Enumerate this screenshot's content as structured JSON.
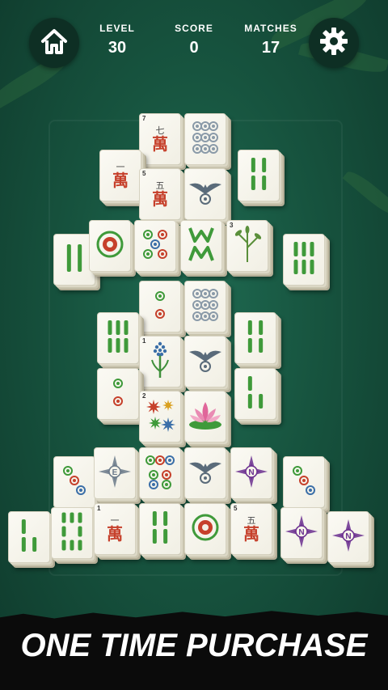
{
  "hud": {
    "level_label": "LEVEL",
    "level_value": "30",
    "score_label": "SCORE",
    "score_value": "0",
    "matches_label": "MATCHES",
    "matches_value": "17",
    "home_icon": "home-icon",
    "settings_icon": "gear-icon"
  },
  "tiles": {
    "t01": {
      "kind": "character",
      "num": "7",
      "top": "七",
      "main": "萬"
    },
    "t02": {
      "kind": "circles-9"
    },
    "t03": {
      "kind": "character",
      "num": "",
      "top": "一",
      "main": "萬"
    },
    "t04": {
      "kind": "character",
      "num": "5",
      "top": "五",
      "main": "萬"
    },
    "t05": {
      "kind": "eagle"
    },
    "t06": {
      "kind": "bamboo",
      "count": 4
    },
    "t07": {
      "kind": "bamboo",
      "count": 2
    },
    "t08": {
      "kind": "circle-1"
    },
    "t09": {
      "kind": "circles-5"
    },
    "t10": {
      "kind": "wm"
    },
    "t11": {
      "kind": "bamboo-plant",
      "num": "3"
    },
    "t12": {
      "kind": "bamboo",
      "count": 6
    },
    "t13": {
      "kind": "circles-2"
    },
    "t14": {
      "kind": "circles-9"
    },
    "t15": {
      "kind": "bamboo",
      "count": 6
    },
    "t16": {
      "kind": "bamboo",
      "count": 4
    },
    "t17": {
      "kind": "flower",
      "num": "1"
    },
    "t18": {
      "kind": "eagle"
    },
    "t19": {
      "kind": "circles-2"
    },
    "t20": {
      "kind": "bamboo",
      "count": 3
    },
    "t21": {
      "kind": "flowers",
      "num": "2"
    },
    "t22": {
      "kind": "lotus"
    },
    "t23": {
      "kind": "circles-3"
    },
    "t24": {
      "kind": "compass",
      "letter": "E"
    },
    "t25": {
      "kind": "circles-7"
    },
    "t26": {
      "kind": "eagle"
    },
    "t27": {
      "kind": "compass",
      "letter": "N"
    },
    "t28": {
      "kind": "circles-3"
    },
    "t29": {
      "kind": "bamboo",
      "count": 3
    },
    "t30": {
      "kind": "bamboo",
      "count": 8
    },
    "t31": {
      "kind": "character",
      "num": "1",
      "top": "一",
      "main": "萬"
    },
    "t32": {
      "kind": "bamboo",
      "count": 4
    },
    "t33": {
      "kind": "circle-1"
    },
    "t34": {
      "kind": "character",
      "num": "5",
      "top": "五",
      "main": "萬"
    },
    "t35": {
      "kind": "compass",
      "letter": "N"
    },
    "t36": {
      "kind": "compass",
      "letter": "N"
    }
  },
  "banner": {
    "text": "ONE TIME PURCHASE"
  },
  "colors": {
    "bamboo": "#3f9a3a",
    "character_red": "#c6402b",
    "compass_purple": "#6b2f8f",
    "background": "#17543f"
  }
}
